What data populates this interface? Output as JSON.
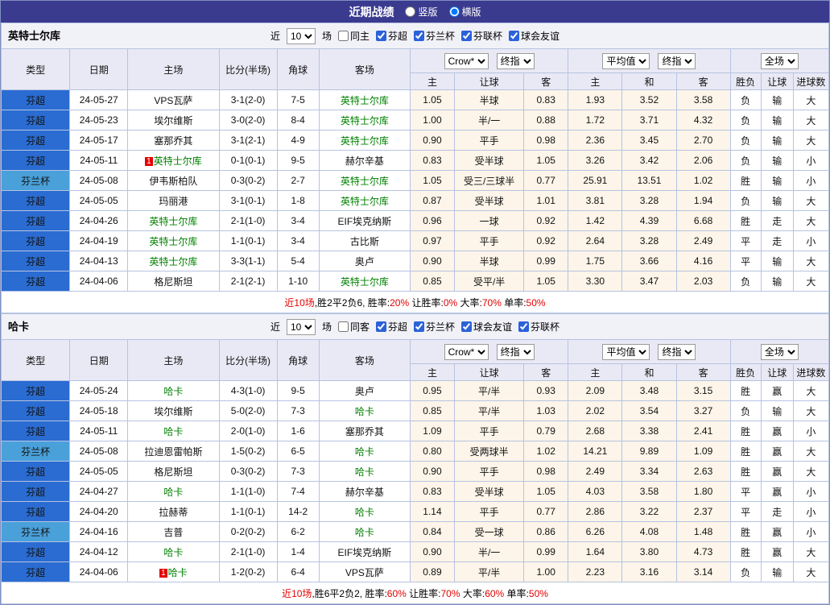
{
  "topbar": {
    "title": "近期战绩",
    "options": [
      {
        "label": "竖版",
        "selected": false
      },
      {
        "label": "横版",
        "selected": true
      }
    ]
  },
  "table_headers": {
    "main": [
      "类型",
      "日期",
      "主场",
      "比分(半场)",
      "角球",
      "客场"
    ],
    "group1": {
      "selects": [
        "Crow*",
        "终指"
      ],
      "cols": [
        "主",
        "让球",
        "客"
      ]
    },
    "group2": {
      "selects": [
        "平均值",
        "终指"
      ],
      "cols": [
        "主",
        "和",
        "客"
      ]
    },
    "group3": {
      "selects": [
        "全场"
      ],
      "cols": [
        "胜负",
        "让球",
        "进球数"
      ]
    }
  },
  "sections": [
    {
      "team": "英特士尔库",
      "filter": {
        "prefix": "近",
        "count": "10",
        "suffix": "场",
        "same": {
          "label": "同主",
          "checked": false
        },
        "leagues": [
          {
            "label": "芬超",
            "checked": true
          },
          {
            "label": "芬兰杯",
            "checked": true
          },
          {
            "label": "芬联杯",
            "checked": true
          },
          {
            "label": "球会友谊",
            "checked": true
          }
        ]
      },
      "rows": [
        {
          "type": "芬超",
          "cup": false,
          "date": "24-05-27",
          "home": "VPS瓦萨",
          "home_self": false,
          "home_red": 0,
          "score": "3-1",
          "half": "(2-0)",
          "corner": "7-5",
          "away": "英特士尔库",
          "away_self": true,
          "away_red": 0,
          "odds": [
            "1.05",
            "半球",
            "0.83"
          ],
          "avg": [
            "1.93",
            "3.52",
            "3.58"
          ],
          "res": [
            [
              "负",
              "b"
            ],
            [
              "输",
              "b"
            ],
            [
              "大",
              "r"
            ]
          ]
        },
        {
          "type": "芬超",
          "cup": false,
          "date": "24-05-23",
          "home": "埃尔维斯",
          "home_self": false,
          "home_red": 0,
          "score": "3-0",
          "half": "(2-0)",
          "corner": "8-4",
          "away": "英特士尔库",
          "away_self": true,
          "away_red": 0,
          "odds": [
            "1.00",
            "半/一",
            "0.88"
          ],
          "avg": [
            "1.72",
            "3.71",
            "4.32"
          ],
          "res": [
            [
              "负",
              "b"
            ],
            [
              "输",
              "b"
            ],
            [
              "大",
              "r"
            ]
          ]
        },
        {
          "type": "芬超",
          "cup": false,
          "date": "24-05-17",
          "home": "塞那乔其",
          "home_self": false,
          "home_red": 0,
          "score": "3-1",
          "half": "(2-1)",
          "corner": "4-9",
          "away": "英特士尔库",
          "away_self": true,
          "away_red": 0,
          "odds": [
            "0.90",
            "平手",
            "0.98"
          ],
          "avg": [
            "2.36",
            "3.45",
            "2.70"
          ],
          "res": [
            [
              "负",
              "b"
            ],
            [
              "输",
              "b"
            ],
            [
              "大",
              "r"
            ]
          ]
        },
        {
          "type": "芬超",
          "cup": false,
          "date": "24-05-11",
          "home": "英特士尔库",
          "home_self": true,
          "home_red": 1,
          "score": "0-1",
          "half": "(0-1)",
          "corner": "9-5",
          "away": "赫尔辛基",
          "away_self": false,
          "away_red": 0,
          "odds": [
            "0.83",
            "受半球",
            "1.05"
          ],
          "avg": [
            "3.26",
            "3.42",
            "2.06"
          ],
          "res": [
            [
              "负",
              "b"
            ],
            [
              "输",
              "b"
            ],
            [
              "小",
              "b"
            ]
          ]
        },
        {
          "type": "芬兰杯",
          "cup": true,
          "date": "24-05-08",
          "home": "伊韦斯柏队",
          "home_self": false,
          "home_red": 0,
          "score": "0-3",
          "half": "(0-2)",
          "corner": "2-7",
          "away": "英特士尔库",
          "away_self": true,
          "away_red": 0,
          "odds": [
            "1.05",
            "受三/三球半",
            "0.77"
          ],
          "avg": [
            "25.91",
            "13.51",
            "1.02"
          ],
          "res": [
            [
              "胜",
              "r"
            ],
            [
              "输",
              "b"
            ],
            [
              "小",
              "b"
            ]
          ]
        },
        {
          "type": "芬超",
          "cup": false,
          "date": "24-05-05",
          "home": "玛丽港",
          "home_self": false,
          "home_red": 0,
          "score": "3-1",
          "half": "(0-1)",
          "corner": "1-8",
          "away": "英特士尔库",
          "away_self": true,
          "away_red": 0,
          "odds": [
            "0.87",
            "受半球",
            "1.01"
          ],
          "avg": [
            "3.81",
            "3.28",
            "1.94"
          ],
          "res": [
            [
              "负",
              "b"
            ],
            [
              "输",
              "b"
            ],
            [
              "大",
              "r"
            ]
          ]
        },
        {
          "type": "芬超",
          "cup": false,
          "date": "24-04-26",
          "home": "英特士尔库",
          "home_self": true,
          "home_red": 0,
          "score": "2-1",
          "half": "(1-0)",
          "corner": "3-4",
          "away": "EIF埃克纳斯",
          "away_self": false,
          "away_red": 0,
          "odds": [
            "0.96",
            "一球",
            "0.92"
          ],
          "avg": [
            "1.42",
            "4.39",
            "6.68"
          ],
          "res": [
            [
              "胜",
              "r"
            ],
            [
              "走",
              "g"
            ],
            [
              "大",
              "r"
            ]
          ]
        },
        {
          "type": "芬超",
          "cup": false,
          "date": "24-04-19",
          "home": "英特士尔库",
          "home_self": true,
          "home_red": 0,
          "score": "1-1",
          "half": "(0-1)",
          "corner": "3-4",
          "away": "古比斯",
          "away_self": false,
          "away_red": 0,
          "odds": [
            "0.97",
            "平手",
            "0.92"
          ],
          "avg": [
            "2.64",
            "3.28",
            "2.49"
          ],
          "res": [
            [
              "平",
              "g"
            ],
            [
              "走",
              "g"
            ],
            [
              "小",
              "b"
            ]
          ]
        },
        {
          "type": "芬超",
          "cup": false,
          "date": "24-04-13",
          "home": "英特士尔库",
          "home_self": true,
          "home_red": 0,
          "score": "3-3",
          "half": "(1-1)",
          "corner": "5-4",
          "away": "奥卢",
          "away_self": false,
          "away_red": 0,
          "odds": [
            "0.90",
            "半球",
            "0.99"
          ],
          "avg": [
            "1.75",
            "3.66",
            "4.16"
          ],
          "res": [
            [
              "平",
              "g"
            ],
            [
              "输",
              "b"
            ],
            [
              "大",
              "r"
            ]
          ]
        },
        {
          "type": "芬超",
          "cup": false,
          "date": "24-04-06",
          "home": "格尼斯坦",
          "home_self": false,
          "home_red": 0,
          "score": "2-1",
          "half": "(2-1)",
          "corner": "1-10",
          "away": "英特士尔库",
          "away_self": true,
          "away_red": 0,
          "odds": [
            "0.85",
            "受平/半",
            "1.05"
          ],
          "avg": [
            "3.30",
            "3.47",
            "2.03"
          ],
          "res": [
            [
              "负",
              "b"
            ],
            [
              "输",
              "b"
            ],
            [
              "大",
              "r"
            ]
          ]
        }
      ],
      "summary": [
        {
          "t": "近10场",
          "c": "red"
        },
        {
          "t": ",胜2平2负6, 胜率:"
        },
        {
          "t": "20%",
          "c": "red"
        },
        {
          "t": " 让胜率:"
        },
        {
          "t": "0%",
          "c": "red"
        },
        {
          "t": " 大率:"
        },
        {
          "t": "70%",
          "c": "red"
        },
        {
          "t": " 单率:"
        },
        {
          "t": "50%",
          "c": "red"
        }
      ]
    },
    {
      "team": "哈卡",
      "filter": {
        "prefix": "近",
        "count": "10",
        "suffix": "场",
        "same": {
          "label": "同客",
          "checked": false
        },
        "leagues": [
          {
            "label": "芬超",
            "checked": true
          },
          {
            "label": "芬兰杯",
            "checked": true
          },
          {
            "label": "球会友谊",
            "checked": true
          },
          {
            "label": "芬联杯",
            "checked": true
          }
        ]
      },
      "rows": [
        {
          "type": "芬超",
          "cup": false,
          "date": "24-05-24",
          "home": "哈卡",
          "home_self": true,
          "home_red": 0,
          "score": "4-3",
          "half": "(1-0)",
          "corner": "9-5",
          "away": "奥卢",
          "away_self": false,
          "away_red": 0,
          "odds": [
            "0.95",
            "平/半",
            "0.93"
          ],
          "avg": [
            "2.09",
            "3.48",
            "3.15"
          ],
          "res": [
            [
              "胜",
              "r"
            ],
            [
              "赢",
              "r"
            ],
            [
              "大",
              "r"
            ]
          ]
        },
        {
          "type": "芬超",
          "cup": false,
          "date": "24-05-18",
          "home": "埃尔维斯",
          "home_self": false,
          "home_red": 0,
          "score": "5-0",
          "half": "(2-0)",
          "corner": "7-3",
          "away": "哈卡",
          "away_self": true,
          "away_red": 0,
          "odds": [
            "0.85",
            "平/半",
            "1.03"
          ],
          "avg": [
            "2.02",
            "3.54",
            "3.27"
          ],
          "res": [
            [
              "负",
              "b"
            ],
            [
              "输",
              "b"
            ],
            [
              "大",
              "r"
            ]
          ]
        },
        {
          "type": "芬超",
          "cup": false,
          "date": "24-05-11",
          "home": "哈卡",
          "home_self": true,
          "home_red": 0,
          "score": "2-0",
          "half": "(1-0)",
          "corner": "1-6",
          "away": "塞那乔其",
          "away_self": false,
          "away_red": 0,
          "odds": [
            "1.09",
            "平手",
            "0.79"
          ],
          "avg": [
            "2.68",
            "3.38",
            "2.41"
          ],
          "res": [
            [
              "胜",
              "r"
            ],
            [
              "赢",
              "r"
            ],
            [
              "小",
              "b"
            ]
          ]
        },
        {
          "type": "芬兰杯",
          "cup": true,
          "date": "24-05-08",
          "home": "拉迪恩雷帕斯",
          "home_self": false,
          "home_red": 0,
          "score": "1-5",
          "half": "(0-2)",
          "corner": "6-5",
          "away": "哈卡",
          "away_self": true,
          "away_red": 0,
          "odds": [
            "0.80",
            "受两球半",
            "1.02"
          ],
          "avg": [
            "14.21",
            "9.89",
            "1.09"
          ],
          "res": [
            [
              "胜",
              "r"
            ],
            [
              "赢",
              "r"
            ],
            [
              "大",
              "r"
            ]
          ]
        },
        {
          "type": "芬超",
          "cup": false,
          "date": "24-05-05",
          "home": "格尼斯坦",
          "home_self": false,
          "home_red": 0,
          "score": "0-3",
          "half": "(0-2)",
          "corner": "7-3",
          "away": "哈卡",
          "away_self": true,
          "away_red": 0,
          "odds": [
            "0.90",
            "平手",
            "0.98"
          ],
          "avg": [
            "2.49",
            "3.34",
            "2.63"
          ],
          "res": [
            [
              "胜",
              "r"
            ],
            [
              "赢",
              "r"
            ],
            [
              "大",
              "r"
            ]
          ]
        },
        {
          "type": "芬超",
          "cup": false,
          "date": "24-04-27",
          "home": "哈卡",
          "home_self": true,
          "home_red": 0,
          "score": "1-1",
          "half": "(1-0)",
          "corner": "7-4",
          "away": "赫尔辛基",
          "away_self": false,
          "away_red": 0,
          "odds": [
            "0.83",
            "受半球",
            "1.05"
          ],
          "avg": [
            "4.03",
            "3.58",
            "1.80"
          ],
          "res": [
            [
              "平",
              "g"
            ],
            [
              "赢",
              "r"
            ],
            [
              "小",
              "b"
            ]
          ]
        },
        {
          "type": "芬超",
          "cup": false,
          "date": "24-04-20",
          "home": "拉赫蒂",
          "home_self": false,
          "home_red": 0,
          "score": "1-1",
          "half": "(0-1)",
          "corner": "14-2",
          "away": "哈卡",
          "away_self": true,
          "away_red": 0,
          "odds": [
            "1.14",
            "平手",
            "0.77"
          ],
          "avg": [
            "2.86",
            "3.22",
            "2.37"
          ],
          "res": [
            [
              "平",
              "g"
            ],
            [
              "走",
              "g"
            ],
            [
              "小",
              "b"
            ]
          ]
        },
        {
          "type": "芬兰杯",
          "cup": true,
          "date": "24-04-16",
          "home": "吉普",
          "home_self": false,
          "home_red": 0,
          "score": "0-2",
          "half": "(0-2)",
          "corner": "6-2",
          "away": "哈卡",
          "away_self": true,
          "away_red": 0,
          "odds": [
            "0.84",
            "受一球",
            "0.86"
          ],
          "avg": [
            "6.26",
            "4.08",
            "1.48"
          ],
          "res": [
            [
              "胜",
              "r"
            ],
            [
              "赢",
              "r"
            ],
            [
              "小",
              "b"
            ]
          ]
        },
        {
          "type": "芬超",
          "cup": false,
          "date": "24-04-12",
          "home": "哈卡",
          "home_self": true,
          "home_red": 0,
          "score": "2-1",
          "half": "(1-0)",
          "corner": "1-4",
          "away": "EIF埃克纳斯",
          "away_self": false,
          "away_red": 0,
          "odds": [
            "0.90",
            "半/一",
            "0.99"
          ],
          "avg": [
            "1.64",
            "3.80",
            "4.73"
          ],
          "res": [
            [
              "胜",
              "r"
            ],
            [
              "赢",
              "r"
            ],
            [
              "大",
              "r"
            ]
          ]
        },
        {
          "type": "芬超",
          "cup": false,
          "date": "24-04-06",
          "home": "哈卡",
          "home_self": true,
          "home_red": 1,
          "score": "1-2",
          "half": "(0-2)",
          "corner": "6-4",
          "away": "VPS瓦萨",
          "away_self": false,
          "away_red": 0,
          "odds": [
            "0.89",
            "平/半",
            "1.00"
          ],
          "avg": [
            "2.23",
            "3.16",
            "3.14"
          ],
          "res": [
            [
              "负",
              "b"
            ],
            [
              "输",
              "b"
            ],
            [
              "大",
              "r"
            ]
          ]
        }
      ],
      "summary": [
        {
          "t": "近10场",
          "c": "red"
        },
        {
          "t": ",胜6平2负2, 胜率:"
        },
        {
          "t": "60%",
          "c": "red"
        },
        {
          "t": " 让胜率:"
        },
        {
          "t": "70%",
          "c": "red"
        },
        {
          "t": " 大率:"
        },
        {
          "t": "60%",
          "c": "red"
        },
        {
          "t": " 单率:"
        },
        {
          "t": "50%",
          "c": "red"
        }
      ]
    }
  ]
}
